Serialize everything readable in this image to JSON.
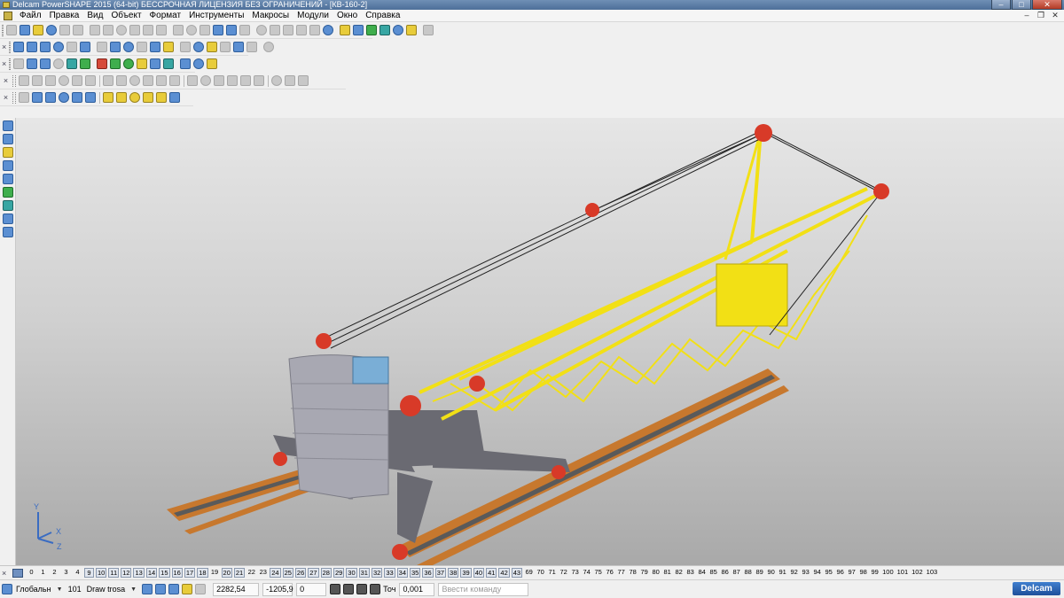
{
  "window": {
    "title": "Delcam PowerSHAPE 2015 (64-bit) БЕССРОЧНАЯ ЛИЦЕНЗИЯ БЕЗ ОГРАНИЧЕНИЙ - [КВ-160-2]",
    "minimize": "–",
    "maximize": "□",
    "close": "✕"
  },
  "menu": {
    "items": [
      "Файл",
      "Правка",
      "Вид",
      "Объект",
      "Формат",
      "Инструменты",
      "Макросы",
      "Модули",
      "Окно",
      "Справка"
    ],
    "mdi_minimize": "–",
    "mdi_restore": "❐",
    "mdi_close": "✕"
  },
  "toolbars": {
    "close_glyph": "×",
    "row1": [
      "gray",
      "blue",
      "yellow",
      "blue",
      "gray",
      "gray",
      "gray",
      "gray",
      "gray",
      "gray",
      "gray",
      "gray",
      "gray",
      "gray",
      "gray",
      "blue",
      "blue",
      "gray",
      "gray",
      "gray",
      "gray",
      "gray",
      "gray",
      "blue",
      "yellow",
      "blue",
      "green",
      "teal",
      "blue",
      "yellow",
      "gray"
    ],
    "row2": [
      "blue",
      "blue",
      "blue",
      "blue",
      "gray",
      "blue",
      "gray",
      "blue",
      "blue",
      "gray",
      "blue",
      "yellow",
      "gray",
      "blue",
      "yellow",
      "gray",
      "blue",
      "gray",
      "gray"
    ],
    "row3": [
      "gray",
      "blue",
      "blue",
      "gray",
      "teal",
      "green",
      "red",
      "green",
      "green",
      "yellow",
      "blue",
      "teal",
      "blue",
      "blue",
      "yellow"
    ],
    "row4": [
      "gray",
      "gray",
      "gray",
      "gray",
      "gray",
      "gray",
      "gray",
      "gray",
      "gray",
      "gray",
      "gray",
      "gray",
      "gray",
      "gray",
      "gray",
      "gray",
      "gray",
      "gray",
      "gray",
      "gray",
      "gray"
    ],
    "row5": [
      "gray",
      "blue",
      "blue",
      "blue",
      "blue",
      "blue",
      "yellow",
      "yellow",
      "yellow",
      "yellow",
      "yellow",
      "blue"
    ],
    "left": [
      "blue",
      "blue",
      "yellow",
      "blue",
      "blue",
      "green",
      "teal",
      "blue",
      "blue"
    ]
  },
  "viewport": {
    "triad": {
      "x": "X",
      "y": "Y",
      "z": "Z"
    },
    "colors": {
      "boom": "#f2e015",
      "counterweight": "#a8a8b2",
      "sheaves": "#d83a28",
      "rails": "#c7782e",
      "base": "#6a6a72",
      "cab": "#7aaed6"
    }
  },
  "levels": {
    "items": [
      "0",
      "1",
      "2",
      "3",
      "4",
      "9",
      "10",
      "11",
      "12",
      "13",
      "14",
      "15",
      "16",
      "17",
      "18",
      "19",
      "20",
      "21",
      "22",
      "23",
      "24",
      "25",
      "26",
      "27",
      "28",
      "29",
      "30",
      "31",
      "32",
      "33",
      "34",
      "35",
      "36",
      "37",
      "38",
      "39",
      "40",
      "41",
      "42",
      "43",
      "69",
      "70",
      "71",
      "72",
      "73",
      "74",
      "75",
      "76",
      "77",
      "78",
      "79",
      "80",
      "81",
      "82",
      "83",
      "84",
      "85",
      "86",
      "87",
      "88",
      "89",
      "90",
      "91",
      "92",
      "93",
      "94",
      "95",
      "96",
      "97",
      "98",
      "99",
      "100",
      "101",
      "102",
      "103"
    ],
    "active": [
      "9",
      "10",
      "11",
      "12",
      "13",
      "14",
      "15",
      "16",
      "17",
      "18",
      "20",
      "21",
      "24",
      "25",
      "26",
      "27",
      "28",
      "29",
      "30",
      "31",
      "32",
      "33",
      "34",
      "35",
      "36",
      "37",
      "38",
      "39",
      "40",
      "41",
      "42",
      "43"
    ]
  },
  "status": {
    "workplane": "Глобальн",
    "level_num": "101",
    "level_name": "Draw trosa",
    "coord_x": "2282,54",
    "coord_y": "-1205,9",
    "coord_z": "0",
    "tolerance_label": "Точ",
    "tolerance_value": "0,001",
    "command_placeholder": "Ввести команду",
    "brand": "Delcam"
  }
}
